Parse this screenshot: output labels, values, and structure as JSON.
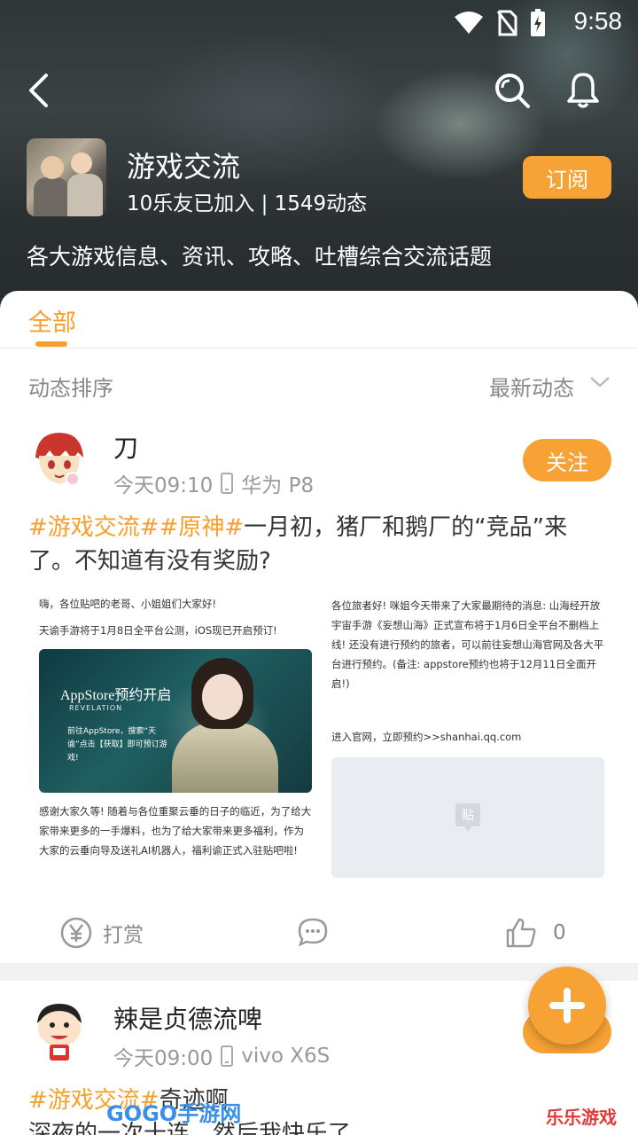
{
  "status_bar": {
    "time": "9:58"
  },
  "forum": {
    "title": "游戏交流",
    "stats": "10乐友已加入 | 1549动态",
    "subscribe_label": "订阅",
    "description": "各大游戏信息、资讯、攻略、吐槽综合交流话题"
  },
  "tabs": {
    "all_label": "全部"
  },
  "sort": {
    "label": "动态排序",
    "value": "最新动态"
  },
  "posts": [
    {
      "username": "刀",
      "time": "今天09:10",
      "device": "华为 P8",
      "follow_label": "关注",
      "hashtag1": "#游戏交流#",
      "hashtag2": "#原神#",
      "text": "一月初，猪厂和鹅厂的“竞品”来了。不知道有没有奖励?",
      "image_left": {
        "line1": "嗨，各位贴吧的老哥、小姐姐们大家好!",
        "line2": "天谕手游将于1月8日全平台公测，iOS现已开启预订!",
        "promo_title": "AppStore预约开启",
        "promo_sub": "REVELATION",
        "promo_text": "前往AppStore，搜索“天谕”点击【获取】即可预订游戏!",
        "footer": "感谢大家久等! 随着与各位重聚云垂的日子的临近，为了给大家带来更多的一手爆料，也为了给大家带来更多福利，作为大家的云垂向导及送礼AI机器人，福利谕正式入驻贴吧啦!"
      },
      "image_right": {
        "body": "各位旅者好! 咪姐今天带来了大家最期待的消息: 山海经开放宇宙手游《妄想山海》正式宣布将于1月6日全平台不删档上线! 还没有进行预约的旅者，可以前往妄想山海官网及各大平台进行预约。(备注: appstore预约也将于12月11日全面开启!)",
        "link": "进入官网，立即预约>>shanhai.qq.com",
        "placeholder_label": "贴"
      },
      "actions": {
        "reward_label": "打赏",
        "like_count": "0"
      }
    },
    {
      "username": "辣是贞德流啤",
      "time": "今天09:00",
      "device": "vivo X6S",
      "hashtag1": "#游戏交流#",
      "text_line1": "奇迹啊",
      "text_line2": "深夜的一次十连，然后我快乐了"
    }
  ],
  "watermarks": {
    "left": "GOGO手游网",
    "right": "乐乐游戏"
  },
  "colors": {
    "accent": "#f7a234",
    "hashtag": "#f5a02c"
  }
}
